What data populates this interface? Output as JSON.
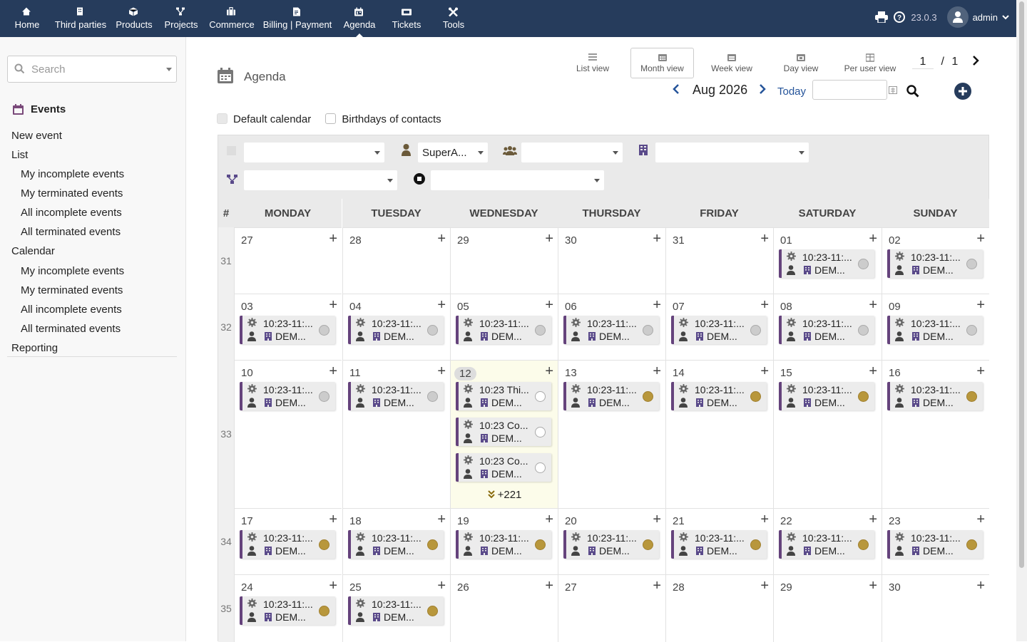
{
  "nav": {
    "items": [
      {
        "label": "Home",
        "icon": "home-icon"
      },
      {
        "label": "Third parties",
        "icon": "building-icon"
      },
      {
        "label": "Products",
        "icon": "cube-icon"
      },
      {
        "label": "Projects",
        "icon": "project-icon"
      },
      {
        "label": "Commerce",
        "icon": "suitcase-icon"
      },
      {
        "label": "Billing | Payment",
        "icon": "invoice-icon"
      },
      {
        "label": "Agenda",
        "icon": "calendar-icon"
      },
      {
        "label": "Tickets",
        "icon": "ticket-icon"
      },
      {
        "label": "Tools",
        "icon": "tools-icon"
      }
    ],
    "active": "Agenda",
    "version": "23.0.3",
    "user": "admin"
  },
  "left": {
    "search_placeholder": "Search",
    "section_title": "Events",
    "items": [
      {
        "label": "New event",
        "level": 0
      },
      {
        "label": "List",
        "level": 0
      },
      {
        "label": "My incomplete events",
        "level": 1
      },
      {
        "label": "My terminated events",
        "level": 1
      },
      {
        "label": "All incomplete events",
        "level": 1
      },
      {
        "label": "All terminated events",
        "level": 1
      },
      {
        "label": "Calendar",
        "level": 0
      },
      {
        "label": "My incomplete events",
        "level": 1
      },
      {
        "label": "My terminated events",
        "level": 1
      },
      {
        "label": "All incomplete events",
        "level": 1
      },
      {
        "label": "All terminated events",
        "level": 1
      },
      {
        "label": "Reporting",
        "level": 0
      }
    ]
  },
  "page": {
    "title": "Agenda",
    "views": [
      "List view",
      "Month view",
      "Week view",
      "Day view",
      "Per user view"
    ],
    "selected_view": "Month view",
    "page_current": "1",
    "page_total": "1",
    "month_label": "Aug 2026",
    "today_label": "Today",
    "checkbox_default": "Default calendar",
    "checkbox_birthdays": "Birthdays of contacts",
    "filter_user": "SuperA..."
  },
  "calendar": {
    "week_header": "#",
    "days": [
      "MONDAY",
      "TUESDAY",
      "WEDNESDAY",
      "THURSDAY",
      "FRIDAY",
      "SATURDAY",
      "SUNDAY"
    ],
    "ev_time": "10:23-11:...",
    "ev_company": "DEM...",
    "weeks": [
      {
        "num": "31",
        "dates": [
          "27",
          "28",
          "29",
          "30",
          "31",
          "01",
          "02"
        ],
        "events": [
          [],
          [],
          [],
          [],
          [],
          [
            "g"
          ],
          [
            "g"
          ]
        ]
      },
      {
        "num": "32",
        "dates": [
          "03",
          "04",
          "05",
          "06",
          "07",
          "08",
          "09"
        ],
        "events": [
          [
            "g"
          ],
          [
            "g"
          ],
          [
            "g"
          ],
          [
            "g"
          ],
          [
            "g"
          ],
          [
            "g"
          ],
          [
            "g"
          ]
        ]
      },
      {
        "num": "33",
        "dates": [
          "10",
          "11",
          "12",
          "13",
          "14",
          "15",
          "16"
        ],
        "events": [
          [
            "g"
          ],
          [
            "g"
          ],
          [
            "o",
            "o",
            "o"
          ],
          [
            "y"
          ],
          [
            "y"
          ],
          [
            "y"
          ],
          [
            "y"
          ]
        ]
      },
      {
        "num": "34",
        "dates": [
          "17",
          "18",
          "19",
          "20",
          "21",
          "22",
          "23"
        ],
        "events": [
          [
            "y"
          ],
          [
            "y"
          ],
          [
            "y"
          ],
          [
            "y"
          ],
          [
            "y"
          ],
          [
            "y"
          ],
          [
            "y"
          ]
        ]
      },
      {
        "num": "35",
        "dates": [
          "24",
          "25",
          "26",
          "27",
          "28",
          "29",
          "30"
        ],
        "events": [
          [
            "y"
          ],
          [
            "y"
          ],
          [],
          [],
          [],
          [],
          []
        ]
      }
    ],
    "today_events": [
      "10:23 Thi...",
      "10:23 Co...",
      "10:23 Co..."
    ],
    "more_label": "+221"
  }
}
